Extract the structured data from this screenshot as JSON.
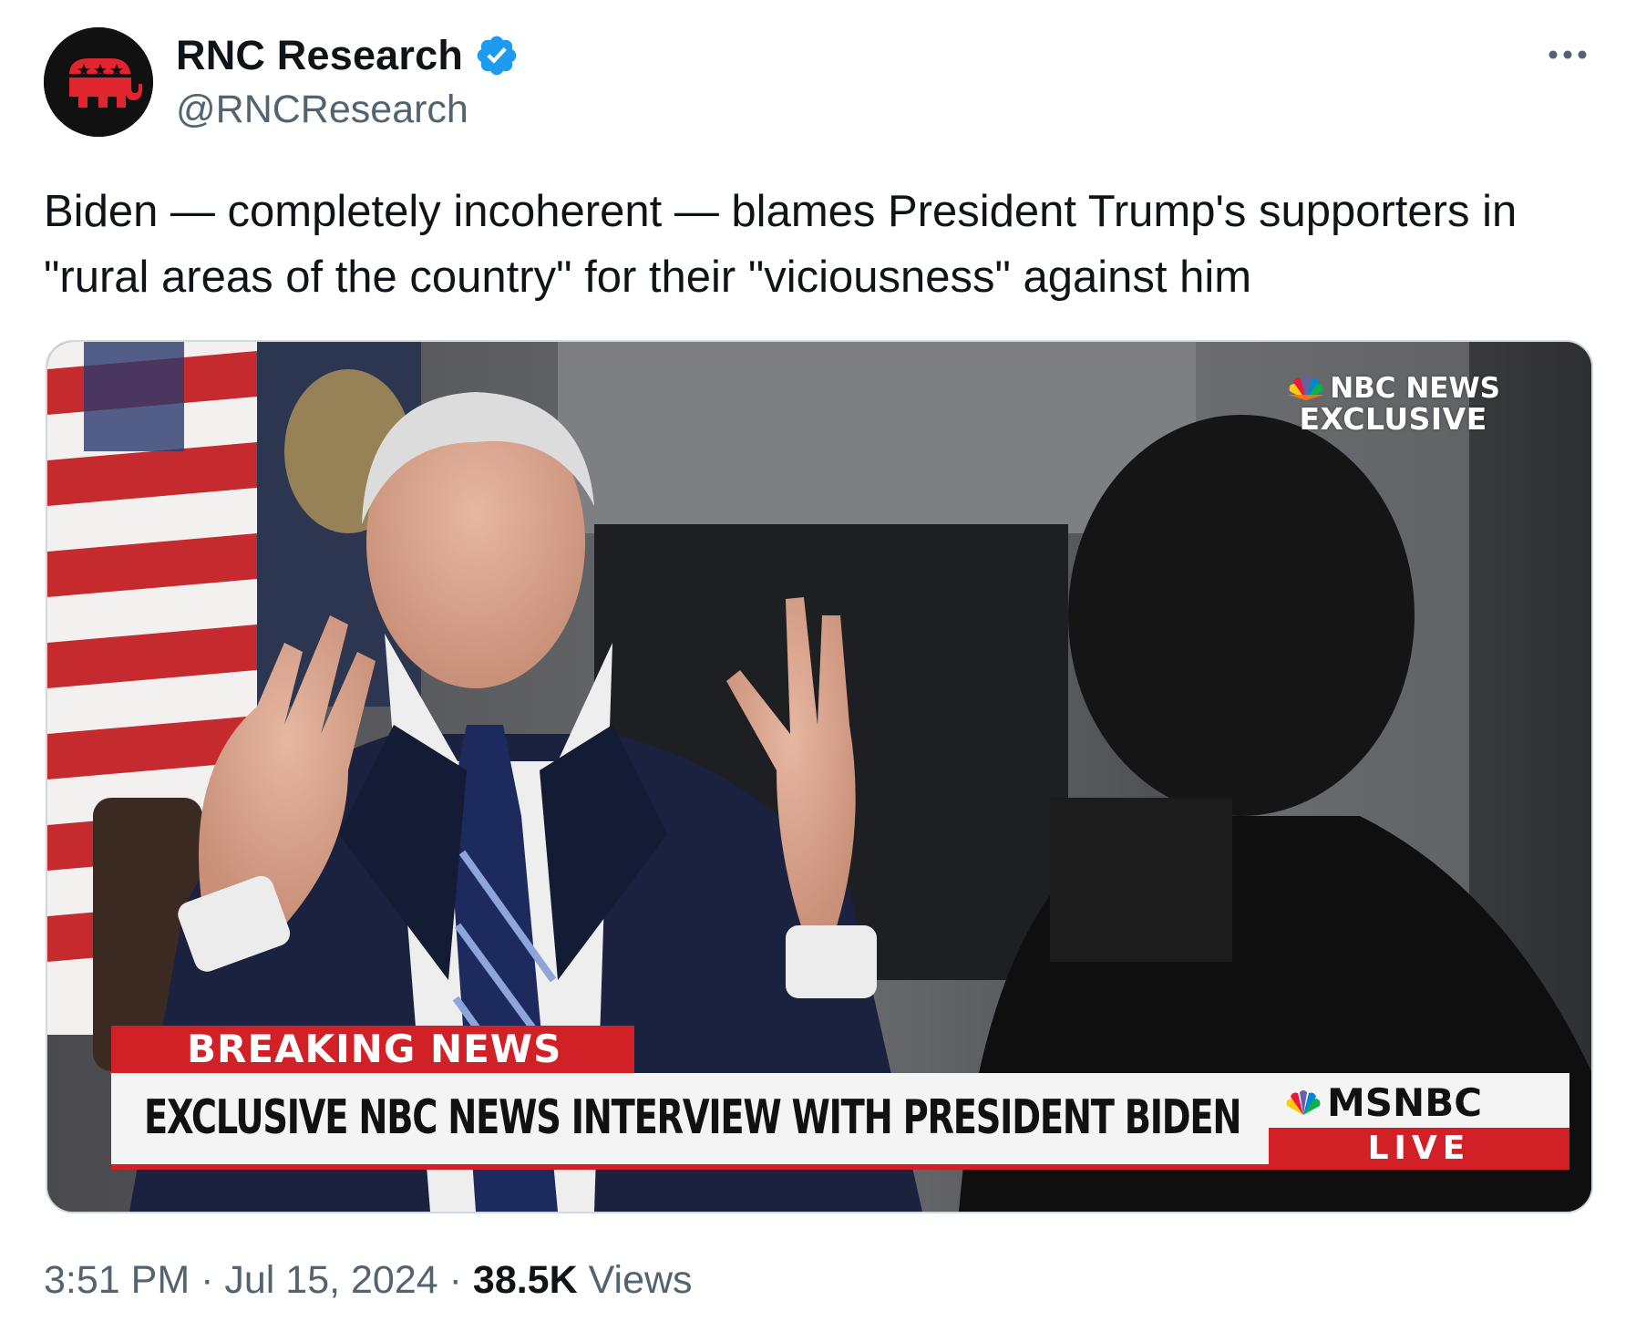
{
  "author": {
    "display_name": "RNC Research",
    "handle": "@RNCResearch",
    "verified": true
  },
  "tweet": {
    "text": "Biden — completely incoherent — blames President Trump's supporters in \"rural areas of the country\" for their \"viciousness\" against him"
  },
  "media": {
    "bug_line1": "NBC NEWS",
    "bug_line2": "EXCLUSIVE",
    "breaking_label": "BREAKING NEWS",
    "headline": "EXCLUSIVE NBC NEWS INTERVIEW WITH PRESIDENT BIDEN",
    "network": "MSNBC",
    "live_label": "LIVE"
  },
  "meta": {
    "time": "3:51 PM",
    "separator": "·",
    "date": "Jul 15, 2024",
    "views_count": "38.5K",
    "views_label": "Views"
  },
  "icons": {
    "avatar": "rnc-elephant-logo",
    "verified": "verified-badge-icon",
    "more": "more-options-icon",
    "network_logo": "peacock-logo"
  },
  "colors": {
    "verified_blue": "#1d9bf0",
    "secondary_text": "#536471",
    "breaking_red": "#d22027"
  }
}
